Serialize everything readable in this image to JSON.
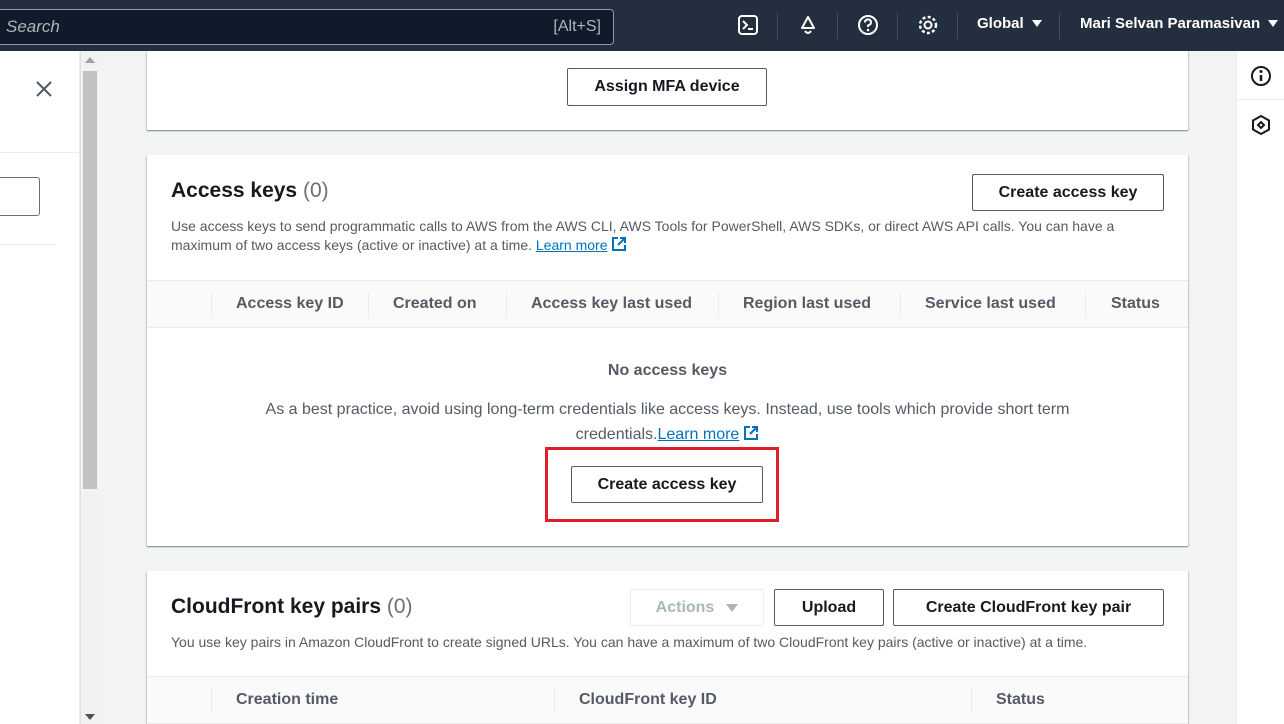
{
  "topnav": {
    "search_placeholder": "Search",
    "search_shortcut": "[Alt+S]",
    "region": "Global",
    "user": "Mari Selvan Paramasivan"
  },
  "mfa": {
    "assign_button": "Assign MFA device"
  },
  "access_keys": {
    "title": "Access keys",
    "count": "(0)",
    "create_button": "Create access key",
    "description": "Use access keys to send programmatic calls to AWS from the AWS CLI, AWS Tools for PowerShell, AWS SDKs, or direct AWS API calls. You can have a maximum of two access keys (active or inactive) at a time.",
    "learn_more": "Learn more",
    "columns": [
      "Access key ID",
      "Created on",
      "Access key last used",
      "Region last used",
      "Service last used",
      "Status"
    ],
    "empty_title": "No access keys",
    "empty_text": "As a best practice, avoid using long-term credentials like access keys. Instead, use tools which provide short term credentials.",
    "empty_learn_more": "Learn more",
    "empty_create_button": "Create access key"
  },
  "cloudfront": {
    "title": "CloudFront key pairs",
    "count": "(0)",
    "actions_button": "Actions",
    "upload_button": "Upload",
    "create_button": "Create CloudFront key pair",
    "description": "You use key pairs in Amazon CloudFront to create signed URLs. You can have a maximum of two CloudFront key pairs (active or inactive) at a time.",
    "columns": [
      "Creation time",
      "CloudFront key ID",
      "Status"
    ]
  },
  "colors": {
    "nav_bg": "#232f3e",
    "link": "#0073bb",
    "highlight": "#e01e2b"
  }
}
